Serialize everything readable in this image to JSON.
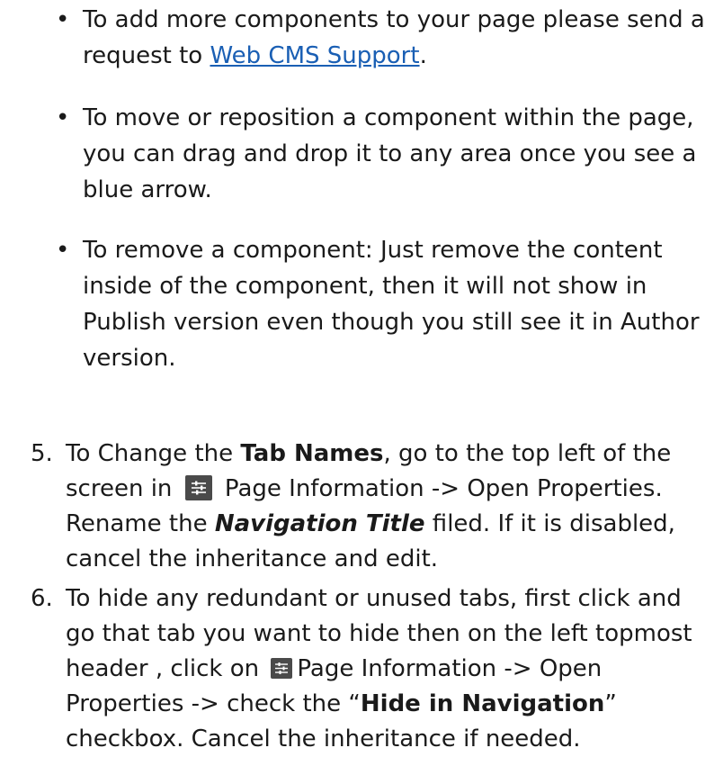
{
  "bullets": [
    {
      "before": "To add more components to your page please send a request to ",
      "link": "Web CMS Support",
      "after": "."
    },
    {
      "text": "To move or reposition a component within the page, you can drag and drop it to any area once you see a blue arrow."
    },
    {
      "text": "To remove a component: Just remove the content inside of the component, then it will not show in Publish version even though you still see it in Author version."
    }
  ],
  "step5": {
    "number": "5.",
    "t1": "To Change the ",
    "bold1": "Tab Names",
    "t2": ", go to the top left of the screen in ",
    "icon": "page-information-icon",
    "t3": " Page Information -> Open Properties. Rename the ",
    "bold2": "Navigation Title",
    "t4": " filed. If it is disabled, cancel the inheritance and edit."
  },
  "step6": {
    "number": "6.",
    "t1": "To hide any redundant or unused tabs, first click and go that tab you want to hide then on the left topmost header , click on ",
    "icon": "page-information-icon",
    "t2": "Page Information -> Open Properties -> check the “",
    "bold1": "Hide in Navigation",
    "t3": "” checkbox. Cancel the inheritance if needed."
  },
  "colors": {
    "link": "#1a5fb4",
    "icon_bg": "#4a4a4a",
    "text": "#1a1a1a"
  }
}
